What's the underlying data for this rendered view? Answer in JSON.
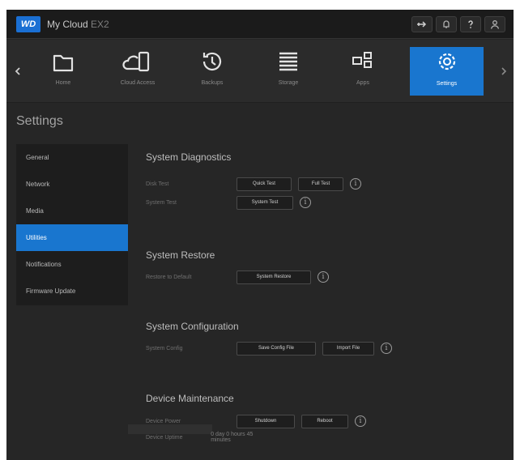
{
  "header": {
    "logo_text": "WD",
    "brand": "My Cloud",
    "model": "EX2",
    "icons": [
      "usb-icon",
      "alert-icon",
      "help-icon",
      "user-icon"
    ]
  },
  "nav": {
    "items": [
      {
        "label": "Home",
        "icon": "home-icon"
      },
      {
        "label": "Cloud Access",
        "icon": "cloud-access-icon"
      },
      {
        "label": "Backups",
        "icon": "backups-icon"
      },
      {
        "label": "Storage",
        "icon": "storage-icon"
      },
      {
        "label": "Apps",
        "icon": "apps-icon"
      },
      {
        "label": "Settings",
        "icon": "settings-icon"
      }
    ],
    "active": "Settings"
  },
  "page": {
    "title": "Settings"
  },
  "sidebar": {
    "items": [
      {
        "label": "General"
      },
      {
        "label": "Network"
      },
      {
        "label": "Media"
      },
      {
        "label": "Utilities"
      },
      {
        "label": "Notifications"
      },
      {
        "label": "Firmware Update"
      }
    ],
    "active": "Utilities"
  },
  "sections": {
    "diagnostics": {
      "title": "System Diagnostics",
      "disk_test_label": "Disk Test",
      "quick_test": "Quick Test",
      "full_test": "Full Test",
      "system_test_label": "System Test",
      "system_test": "System Test"
    },
    "restore": {
      "title": "System Restore",
      "restore_label": "Restore to Default",
      "restore_button": "System Restore"
    },
    "configuration": {
      "title": "System Configuration",
      "config_label": "System Config",
      "save_button": "Save Config File",
      "import_button": "Import File"
    },
    "maintenance": {
      "title": "Device Maintenance",
      "power_label": "Device Power",
      "shutdown_button": "Shutdown",
      "reboot_button": "Reboot",
      "uptime_label": "Device Uptime",
      "uptime_value": "0 day 0 hours 45 minutes"
    }
  },
  "colors": {
    "accent": "#1976cf",
    "background": "#262626",
    "topbar": "#1b1b1b"
  }
}
